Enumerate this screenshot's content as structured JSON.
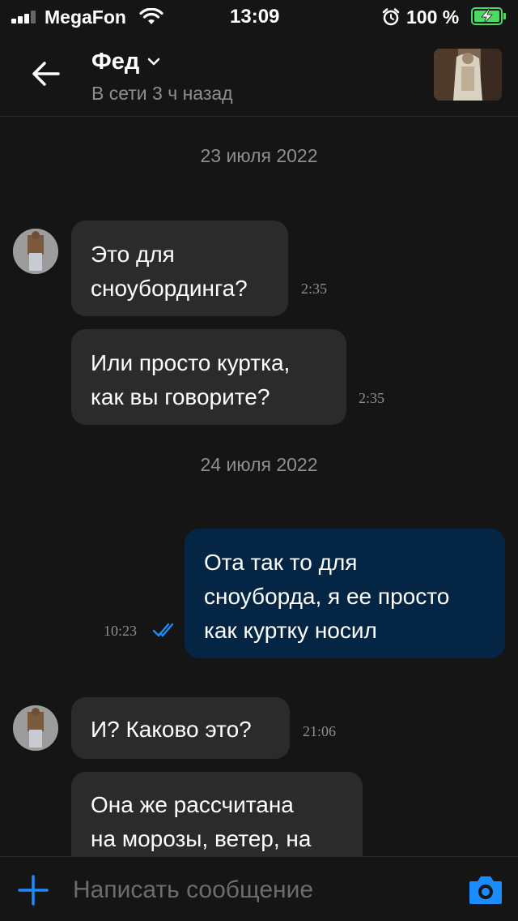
{
  "status_bar": {
    "carrier": "MegaFon",
    "time": "13:09",
    "battery": "100 %",
    "icons": [
      "signal-icon",
      "wifi-icon",
      "alarm-icon",
      "battery-charging-icon"
    ]
  },
  "header": {
    "contact_name": "Фед",
    "contact_status": "В сети 3 ч назад",
    "icons": [
      "back-arrow-icon",
      "chevron-down-icon"
    ]
  },
  "messages": [
    {
      "type": "date",
      "text": "23 июля 2022"
    },
    {
      "type": "incoming",
      "lines": [
        "Это для",
        "сноубординга?"
      ],
      "time": "2:35"
    },
    {
      "type": "incoming",
      "lines": [
        "Или просто куртка,",
        "как вы говорите?"
      ],
      "time": "2:35"
    },
    {
      "type": "date",
      "text": "24 июля 2022"
    },
    {
      "type": "outgoing",
      "lines": [
        "Ота так то для",
        "сноуборда, я ее просто",
        "как куртку носил"
      ],
      "time": "10:23",
      "status": "read"
    },
    {
      "type": "incoming",
      "lines": [
        "И? Каково это?"
      ],
      "time": "21:06"
    },
    {
      "type": "incoming",
      "lines": [
        "Она же рассчитана",
        "на морозы, ветер, на"
      ],
      "time": ""
    }
  ],
  "input_bar": {
    "placeholder": "Написать сообщение",
    "icons": [
      "plus-icon",
      "camera-icon"
    ]
  },
  "colors": {
    "background": "#151515",
    "incoming_bubble": "#2b2b2b",
    "outgoing_bubble": "#052544",
    "accent": "#1a8cff",
    "battery_green": "#4cd964"
  }
}
